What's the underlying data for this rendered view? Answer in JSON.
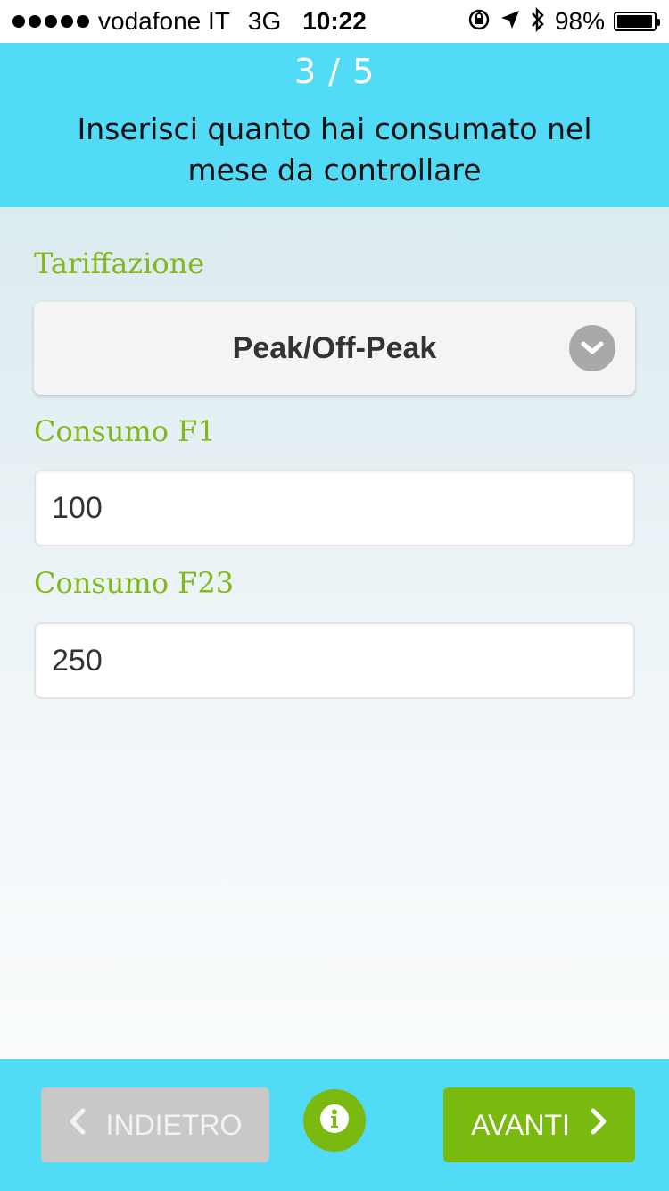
{
  "status_bar": {
    "carrier": "vodafone IT",
    "network": "3G",
    "time": "10:22",
    "battery": "98%",
    "battery_level": 0.98,
    "icons": [
      "signal-dots-icon",
      "rotation-lock-icon",
      "location-arrow-icon",
      "bluetooth-icon",
      "battery-icon"
    ]
  },
  "header": {
    "step": "3 / 5",
    "instruction": "Inserisci quanto hai consumato nel mese da controllare"
  },
  "form": {
    "tariff_label": "Tariffazione",
    "tariff_value": "Peak/Off-Peak",
    "f1_label": "Consumo F1",
    "f1_value": "100",
    "f23_label": "Consumo F23",
    "f23_value": "250"
  },
  "footer": {
    "back_label": "INDIETRO",
    "next_label": "AVANTI",
    "info_icon": "info-icon"
  },
  "colors": {
    "header_bg": "#52dbf7",
    "label_green": "#82b81a",
    "button_green": "#7ab910",
    "button_disabled": "#c8c8c8"
  }
}
